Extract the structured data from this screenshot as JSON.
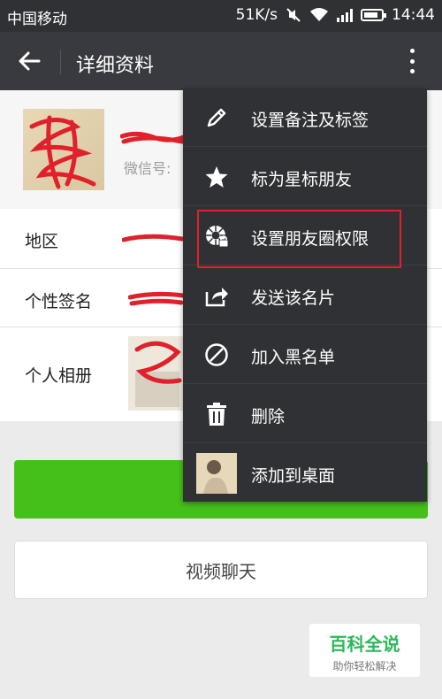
{
  "status_bar": {
    "carrier": "中国移动",
    "net_speed": "51K/s",
    "time": "14:44"
  },
  "header": {
    "title": "详细资料"
  },
  "profile": {
    "wechat_id_label": "微信号:"
  },
  "info_rows": [
    {
      "label": "地区"
    },
    {
      "label": "个性签名"
    },
    {
      "label": "个人相册"
    }
  ],
  "buttons": {
    "video_chat": "视频聊天"
  },
  "menu": {
    "items": [
      {
        "label": "设置备注及标签",
        "icon": "pencil-icon"
      },
      {
        "label": "标为星标朋友",
        "icon": "star-icon"
      },
      {
        "label": "设置朋友圈权限",
        "icon": "moments-lock-icon"
      },
      {
        "label": "发送该名片",
        "icon": "share-icon"
      },
      {
        "label": "加入黑名单",
        "icon": "block-icon"
      },
      {
        "label": "删除",
        "icon": "trash-icon"
      },
      {
        "label": "添加到桌面",
        "icon": "avatar-thumbnail"
      }
    ]
  },
  "watermark": {
    "title": "百科全说",
    "subtitle": "助你轻松解决"
  },
  "colors": {
    "header": "#393a3f",
    "menu": "#2f3135",
    "green": "#45c01a",
    "highlight": "#e0202a"
  }
}
